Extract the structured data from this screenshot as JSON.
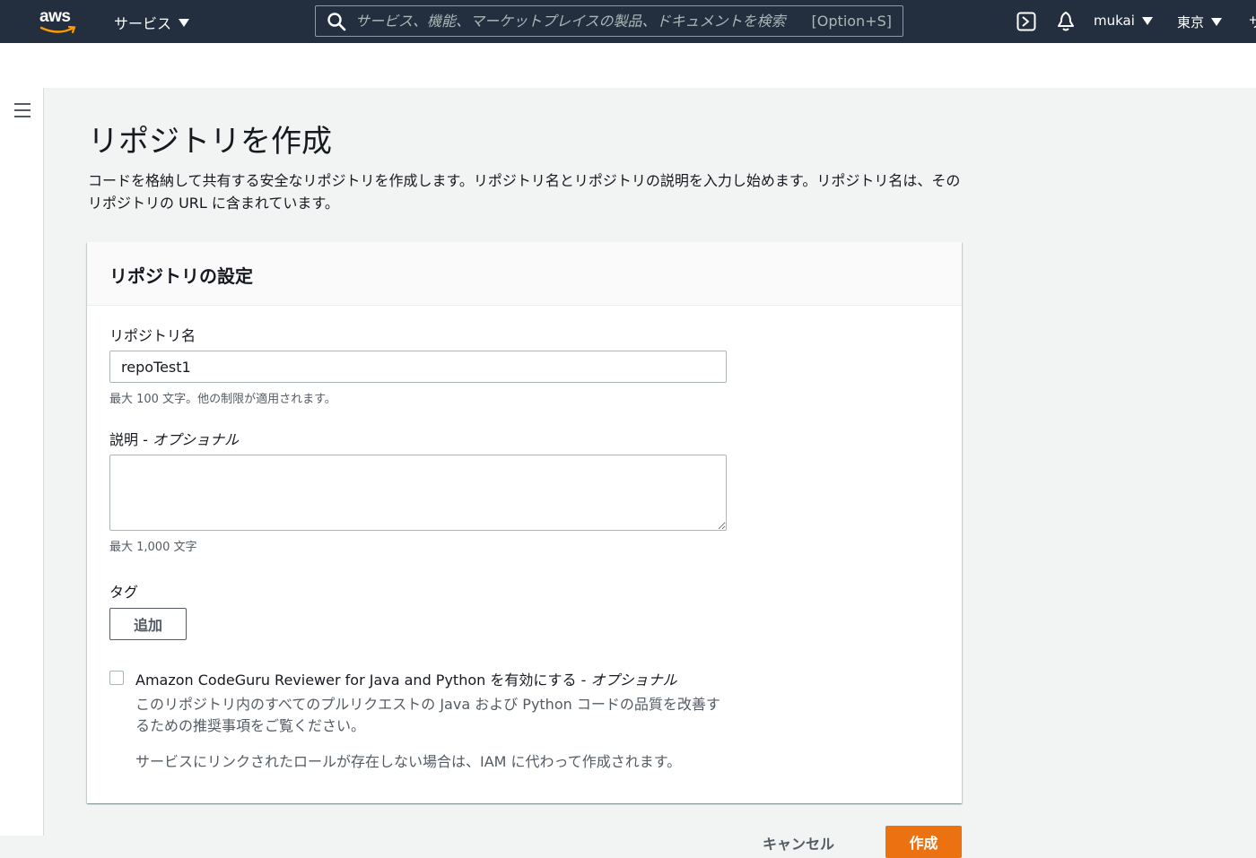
{
  "nav": {
    "logo_text": "aws",
    "services_label": "サービス",
    "search_placeholder": "サービス、機能、マーケットプレイスの製品、ドキュメントを検索",
    "search_shortcut": "[Option+S]",
    "user_label": "mukai",
    "region_label": "東京",
    "support_label": "サ"
  },
  "page": {
    "title": "リポジトリを作成",
    "description": "コードを格納して共有する安全なリポジトリを作成します。リポジトリ名とリポジトリの説明を入力し始めます。リポジトリ名は、そのリポジトリの URL に含まれています。"
  },
  "panel": {
    "title": "リポジトリの設定",
    "repo_name_label": "リポジトリ名",
    "repo_name_value": "repoTest1",
    "repo_name_hint": "最大 100 文字。他の制限が適用されます。",
    "description_label": "説明 - ",
    "description_optional": "オプショナル",
    "description_value": "",
    "description_hint": "最大 1,000 文字",
    "tags_label": "タグ",
    "add_button": "追加",
    "codeguru_label": "Amazon CodeGuru Reviewer for Java and Python を有効にする - ",
    "codeguru_optional": "オプショナル",
    "codeguru_desc": "このリポジトリ内のすべてのプルリクエストの Java および Python コードの品質を改善するための推奨事項をご覧ください。",
    "codeguru_note": "サービスにリンクされたロールが存在しない場合は、IAM に代わって作成されます。",
    "codeguru_checked": false
  },
  "footer": {
    "cancel_label": "キャンセル",
    "create_label": "作成"
  },
  "colors": {
    "nav_bg": "#232f3e",
    "primary": "#ec7211",
    "page_bg": "#f2f3f3"
  },
  "icons": [
    "search-icon",
    "cloudshell-icon",
    "bell-icon",
    "caret-down-icon",
    "hamburger-icon"
  ]
}
